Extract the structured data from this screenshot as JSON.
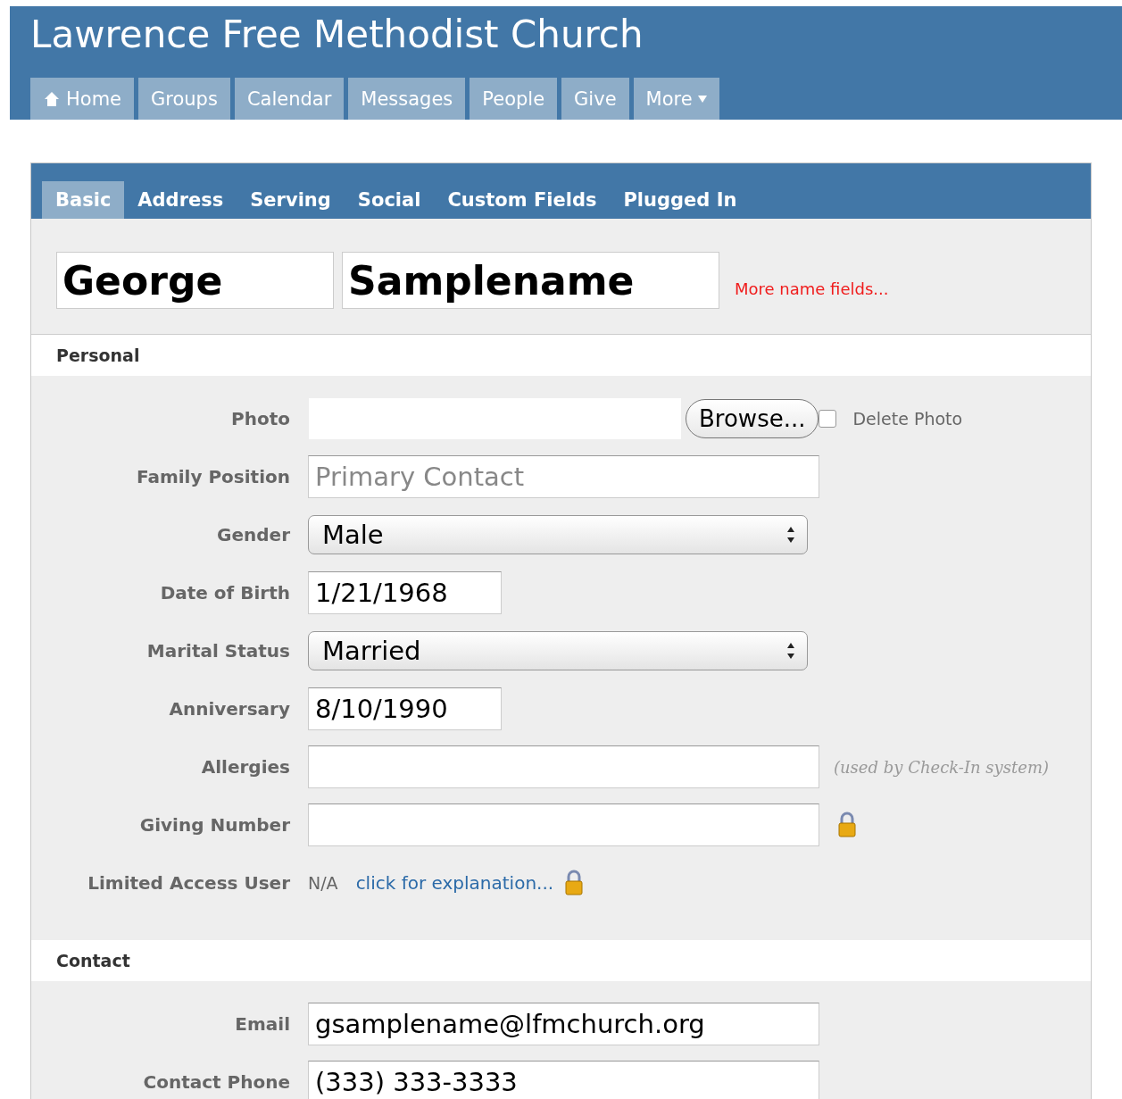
{
  "site_title": "Lawrence Free Methodist Church",
  "nav": [
    {
      "label": "Home",
      "kind": "home"
    },
    {
      "label": "Groups",
      "kind": "plain"
    },
    {
      "label": "Calendar",
      "kind": "plain"
    },
    {
      "label": "Messages",
      "kind": "plain"
    },
    {
      "label": "People",
      "kind": "plain"
    },
    {
      "label": "Give",
      "kind": "plain"
    },
    {
      "label": "More",
      "kind": "menu"
    }
  ],
  "tabs": [
    {
      "label": "Basic",
      "selected": true
    },
    {
      "label": "Address",
      "selected": false
    },
    {
      "label": "Serving",
      "selected": false
    },
    {
      "label": "Social",
      "selected": false
    },
    {
      "label": "Custom Fields",
      "selected": false
    },
    {
      "label": "Plugged In",
      "selected": false
    }
  ],
  "name": {
    "first": "George",
    "last": "Samplename",
    "more_link": "More name fields..."
  },
  "sections": [
    {
      "title": "Personal",
      "fields": [
        {
          "label": "Photo",
          "kind": "file",
          "button": "Browse...",
          "checkbox_label": "Delete Photo",
          "checked": false
        },
        {
          "label": "Family Position",
          "kind": "text",
          "placeholder": "Primary Contact"
        },
        {
          "label": "Gender",
          "kind": "select",
          "value": "Male"
        },
        {
          "label": "Date of Birth",
          "kind": "date",
          "value": "1/21/1968"
        },
        {
          "label": "Marital Status",
          "kind": "select",
          "value": "Married"
        },
        {
          "label": "Anniversary",
          "kind": "date",
          "value": "8/10/1990"
        },
        {
          "label": "Allergies",
          "kind": "text",
          "note": "(used by Check-In system)"
        },
        {
          "label": "Giving Number",
          "kind": "text",
          "locked": true
        },
        {
          "label": "Limited Access User",
          "kind": "static",
          "value": "N/A",
          "link": "click for explanation...",
          "locked": true
        }
      ]
    },
    {
      "title": "Contact",
      "fields": [
        {
          "label": "Email",
          "kind": "text",
          "value": "gsamplename@lfmchurch.org"
        },
        {
          "label": "Contact Phone",
          "kind": "text",
          "value": "(333) 333-3333"
        }
      ]
    }
  ]
}
